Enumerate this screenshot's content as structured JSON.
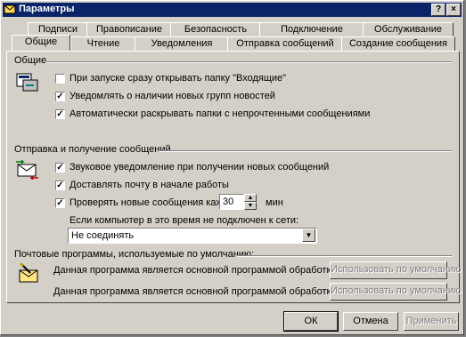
{
  "window": {
    "title": "Параметры",
    "help_label": "?",
    "close_label": "×"
  },
  "tabs_back": [
    "Подписи",
    "Правописание",
    "Безопасность",
    "Подключение",
    "Обслуживание"
  ],
  "tabs_front": [
    "Общие",
    "Чтение",
    "Уведомления",
    "Отправка сообщений",
    "Создание сообщения"
  ],
  "active_tab": "Общие",
  "general": {
    "label": "Общие",
    "options": [
      {
        "label": "При запуске сразу открывать папку \"Входящие\"",
        "checked": false
      },
      {
        "label": "Уведомлять о наличии новых групп новостей",
        "checked": true
      },
      {
        "label": "Автоматически раскрывать папки с непрочтенными сообщениями",
        "checked": true
      }
    ]
  },
  "send_receive": {
    "label": "Отправка и получение сообщений",
    "options": [
      {
        "label": "Звуковое уведомление при получении новых сообщений",
        "checked": true
      },
      {
        "label": "Доставлять почту в начале работы",
        "checked": true
      },
      {
        "label": "Проверять новые сообщения каждые",
        "checked": true
      }
    ],
    "interval_value": "30",
    "interval_unit": "мин",
    "offline_label": "Если компьютер в это время не подключен к сети:",
    "offline_select": "Не соединять"
  },
  "default_programs": {
    "label": "Почтовые программы, используемые по умолчанию:",
    "mail_text": "Данная программа является основной программой обработки почты",
    "mail_button": "Использовать по умолчанию",
    "news_text": "Данная программа является основной программой обработки",
    "news_button": "Использовать по умолчанию"
  },
  "footer": {
    "ok": "ОК",
    "cancel": "Отмена",
    "apply": "Применить"
  },
  "colors": {
    "titlebar": "#0a246a",
    "face": "#d4d0c8",
    "check": "#000000"
  }
}
